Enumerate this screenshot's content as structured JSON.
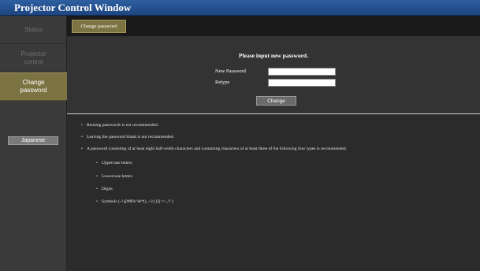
{
  "window": {
    "title": "Projector Control Window"
  },
  "sidebar": {
    "items": [
      {
        "label": "Status"
      },
      {
        "label": "Projector control"
      },
      {
        "label": "Change password"
      }
    ],
    "language_button": "Japanese"
  },
  "tabs": [
    {
      "label": "Change password"
    }
  ],
  "form": {
    "heading": "Please input new password.",
    "new_password_label": "New Password",
    "new_password_value": "",
    "retype_label": "Retype",
    "retype_value": "",
    "change_button": "Change"
  },
  "notes": {
    "items": [
      "Reusing passwords is not recommended.",
      "Leaving the password blank is not recommended.",
      "A password consisting of at least eight half-width characters and containing characters of at least three of the following four types is recommended."
    ],
    "types": [
      "Uppercase letters",
      "Lowercase letters",
      "Digits",
      "Symbols (~!@#$%^&*()_+|\\{}[]<>.,/? )"
    ]
  },
  "colors": {
    "title_bar": "#2e5fa0",
    "active_accent": "#7c7342",
    "background": "#2b2b2b"
  }
}
